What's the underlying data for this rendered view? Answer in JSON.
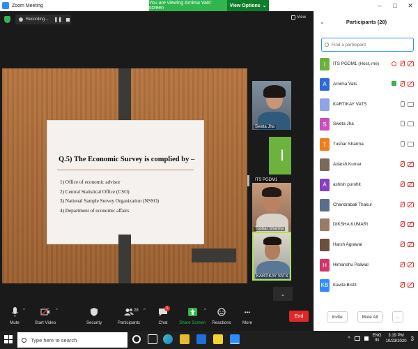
{
  "window": {
    "title": "Zoom Meeting",
    "share_banner": "You are viewing Arnima Vats' screen",
    "view_options": "View Options",
    "view_options_caret": "⌄",
    "minimize": "–",
    "maximize": "□",
    "close": "✕"
  },
  "topbar": {
    "recording_label": "Recording...",
    "pause": "❚❚",
    "view_label": "View"
  },
  "slide": {
    "question": "Q.5) The Economic Survey is complied by –",
    "options": [
      "1) Office of economic advisor",
      "2) Central Statistical Office (CSO)",
      "3) National Sample Survey Organization (NSSO)",
      "4) Department of economic affairs"
    ]
  },
  "tiles": [
    {
      "name": "Sweta Jha"
    },
    {
      "name": "ITS PGDM1",
      "initial": "I"
    },
    {
      "name": "Tushar Sharma"
    },
    {
      "name": "KARTIKAY VATS"
    }
  ],
  "tile_chevron": "⌄",
  "toolbar": {
    "mute": "Mute",
    "start_video": "Start Video",
    "security": "Security",
    "participants": "Participants",
    "participants_count": "28",
    "chat": "Chat",
    "chat_badge": "1",
    "share_screen": "Share Screen",
    "reactions": "Reactions",
    "more": "More",
    "end": "End",
    "caret": "^",
    "more_glyph": "•••"
  },
  "panel": {
    "title": "Participants (28)",
    "chevron": "⌄",
    "search_placeholder": "Find a participant",
    "participants": [
      {
        "initial": "I",
        "name": "ITS PGDM1 (Host, me)",
        "color": "#6cb33e",
        "mic": "off",
        "cam": "off",
        "rec": true
      },
      {
        "initial": "A",
        "name": "Arnima Vats",
        "color": "#2d6bd6",
        "mic": "off",
        "cam": "off",
        "share": true
      },
      {
        "initial": "",
        "name": "KARTIKAY VATS",
        "color": "#8fa3e8",
        "mic": "on",
        "cam": "on",
        "photo": true
      },
      {
        "initial": "S",
        "name": "Sweta Jha",
        "color": "#c94fbf",
        "mic": "on",
        "cam": "on"
      },
      {
        "initial": "T",
        "name": "Tushar Sharma",
        "color": "#f07d1a",
        "mic": "on",
        "cam": "on"
      },
      {
        "initial": "",
        "name": "Adarsh Kumar",
        "color": "#7a6a5c",
        "mic": "off",
        "cam": "off",
        "photo": true
      },
      {
        "initial": "A",
        "name": "ashish purohit",
        "color": "#8a3fc2",
        "mic": "off",
        "cam": "off"
      },
      {
        "initial": "",
        "name": "Chandrabali Thakur",
        "color": "#5c6d8a",
        "mic": "off",
        "cam": "off",
        "photo": true
      },
      {
        "initial": "",
        "name": "DIKSHA KUMARI",
        "color": "#9a7b6a",
        "mic": "off",
        "cam": "off",
        "photo": true
      },
      {
        "initial": "",
        "name": "Harsh Agrawal",
        "color": "#6b5040",
        "mic": "off",
        "cam": "off",
        "photo": true
      },
      {
        "initial": "H",
        "name": "Himanshu Paliwal",
        "color": "#d6336c",
        "mic": "off",
        "cam": "off"
      },
      {
        "initial": "KB",
        "name": "Kavita Bisht",
        "color": "#2d8cff",
        "mic": "off",
        "cam": "off"
      }
    ],
    "invite": "Invite",
    "mute_all": "Mute All",
    "more": "..."
  },
  "taskbar": {
    "search_text": "Type here to search",
    "lang": "ENG",
    "region": "IN",
    "time": "3:19 PM",
    "date": "10/23/2020",
    "notifications": "3"
  },
  "colors": {
    "accent": "#2d8cff",
    "green": "#2fb64e",
    "red": "#e53935"
  }
}
